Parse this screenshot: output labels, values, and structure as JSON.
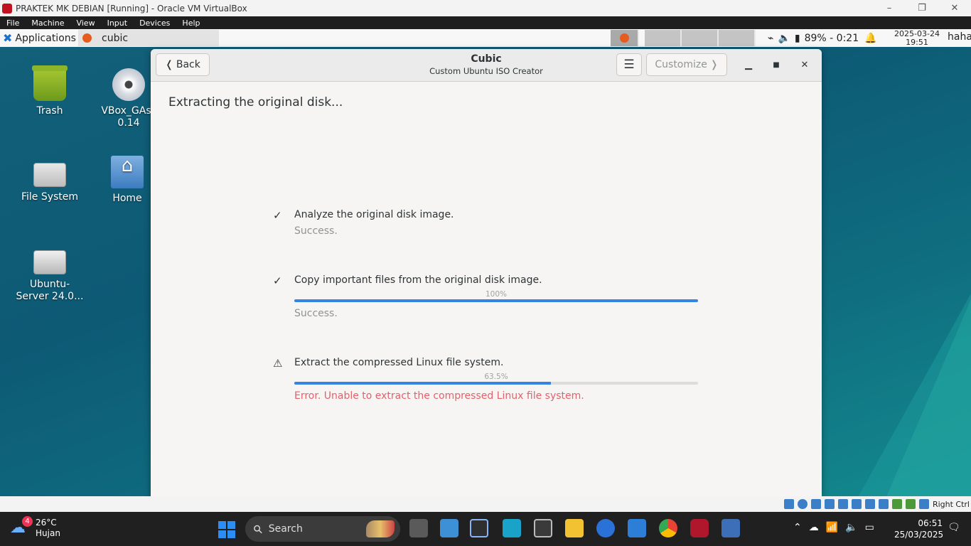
{
  "vbox": {
    "title": "PRAKTEK MK DEBIAN [Running] - Oracle VM VirtualBox",
    "controls": [
      "–",
      "❐",
      "✕"
    ],
    "menu": [
      "File",
      "Machine",
      "View",
      "Input",
      "Devices",
      "Help"
    ],
    "status_right": "Right Ctrl"
  },
  "panel": {
    "applications_label": "Applications",
    "task_label": "cubic",
    "battery_text": "89% - 0:21",
    "date": "2025-03-24",
    "time": "19:51",
    "user": "haha"
  },
  "desktop_icons": {
    "trash": "Trash",
    "vbox_line1": "VBox_GAs_",
    "vbox_line2": "0.14",
    "filesystem": "File System",
    "home": "Home",
    "server_line1": "Ubuntu-",
    "server_line2": "Server 24.0..."
  },
  "cubic": {
    "back_label": "Back",
    "title": "Cubic",
    "subtitle": "Custom Ubuntu ISO Creator",
    "customize_label": "Customize",
    "heading": "Extracting the original disk...",
    "steps": [
      {
        "label": "Analyze the original disk image.",
        "status": "Success.",
        "mark": "check"
      },
      {
        "label": "Copy important files from the original disk image.",
        "percent": "100%",
        "progress": 1.0,
        "status": "Success.",
        "mark": "check"
      },
      {
        "label": "Extract the compressed Linux file system.",
        "percent": "63.5%",
        "progress": 0.635,
        "status": "Error. Unable to extract the compressed Linux file system.",
        "mark": "warning"
      }
    ]
  },
  "taskbar": {
    "weather_badge": "4",
    "temperature": "26°C",
    "condition": "Hujan",
    "search_label": "Search",
    "time": "06:51",
    "date": "25/03/2025"
  },
  "colors": {
    "accent": "#3584e4",
    "error": "#e2626b",
    "win_accent": "#2a8ef5"
  }
}
